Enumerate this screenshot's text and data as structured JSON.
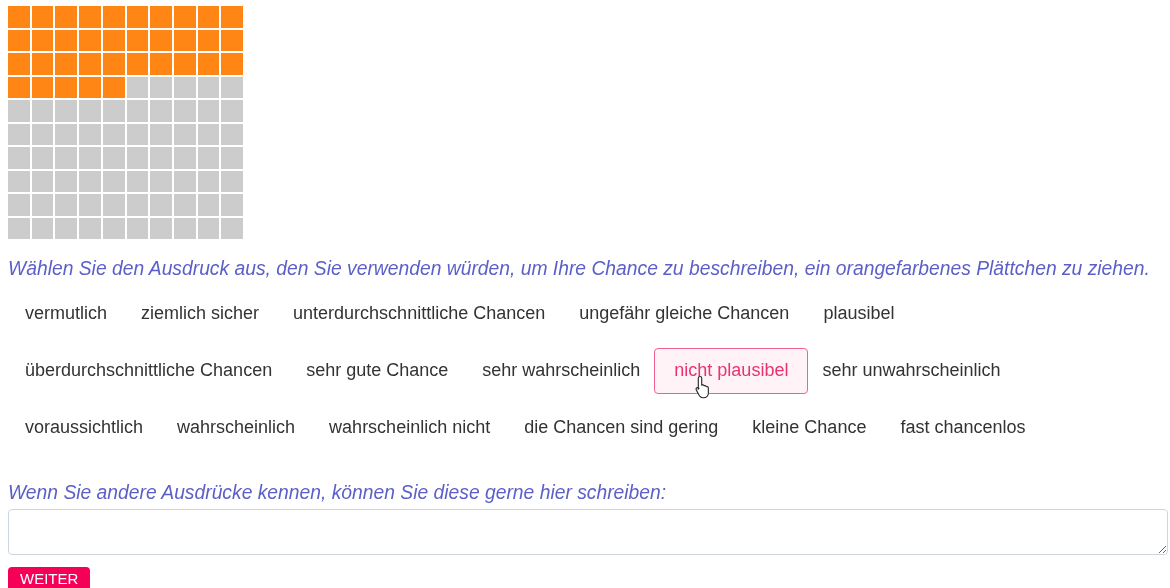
{
  "question": "Wählen Sie den Ausdruck aus, den Sie verwenden würden, um Ihre Chance zu beschreiben, ein orangefarbenes Plättchen zu ziehen.",
  "options": [
    {
      "label": "vermutlich",
      "selected": false
    },
    {
      "label": "ziemlich sicher",
      "selected": false
    },
    {
      "label": "unterdurchschnittliche Chancen",
      "selected": false
    },
    {
      "label": "ungefähr gleiche Chancen",
      "selected": false
    },
    {
      "label": "plausibel",
      "selected": false
    },
    {
      "label": "überdurchschnittliche Chancen",
      "selected": false
    },
    {
      "label": "sehr gute Chance",
      "selected": false
    },
    {
      "label": "sehr wahrscheinlich",
      "selected": false
    },
    {
      "label": "nicht plausibel",
      "selected": true
    },
    {
      "label": "sehr unwahrscheinlich",
      "selected": false
    },
    {
      "label": "voraussichtlich",
      "selected": false
    },
    {
      "label": "wahrscheinlich",
      "selected": false
    },
    {
      "label": "wahrscheinlich nicht",
      "selected": false
    },
    {
      "label": "die Chancen sind gering",
      "selected": false
    },
    {
      "label": "kleine Chance",
      "selected": false
    },
    {
      "label": "fast chancenlos",
      "selected": false
    }
  ],
  "other_prompt": "Wenn Sie andere Ausdrücke kennen, können Sie diese gerne hier schreiben:",
  "next_button": "WEITER"
}
